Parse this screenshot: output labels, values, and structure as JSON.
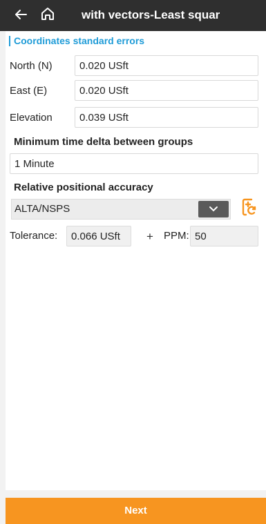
{
  "header": {
    "title": "with vectors-Least squar"
  },
  "section": {
    "title": "Coordinates standard errors"
  },
  "errors": {
    "north_label": "North (N)",
    "north_value": "0.020 USft",
    "east_label": "East (E)",
    "east_value": "0.020 USft",
    "elevation_label": "Elevation",
    "elevation_value": "0.039 USft"
  },
  "time_delta": {
    "heading": "Minimum time delta between groups",
    "value": "1 Minute"
  },
  "accuracy": {
    "heading": "Relative positional accuracy",
    "selected": "ALTA/NSPS",
    "tolerance_label": "Tolerance:",
    "tolerance_value": "0.066 USft",
    "plus": "+",
    "ppm_label": "PPM:",
    "ppm_value": "50"
  },
  "footer": {
    "next_label": "Next"
  },
  "colors": {
    "accent": "#1e9bd7",
    "primary_button": "#f79520",
    "topbar": "#2f2f2f"
  }
}
